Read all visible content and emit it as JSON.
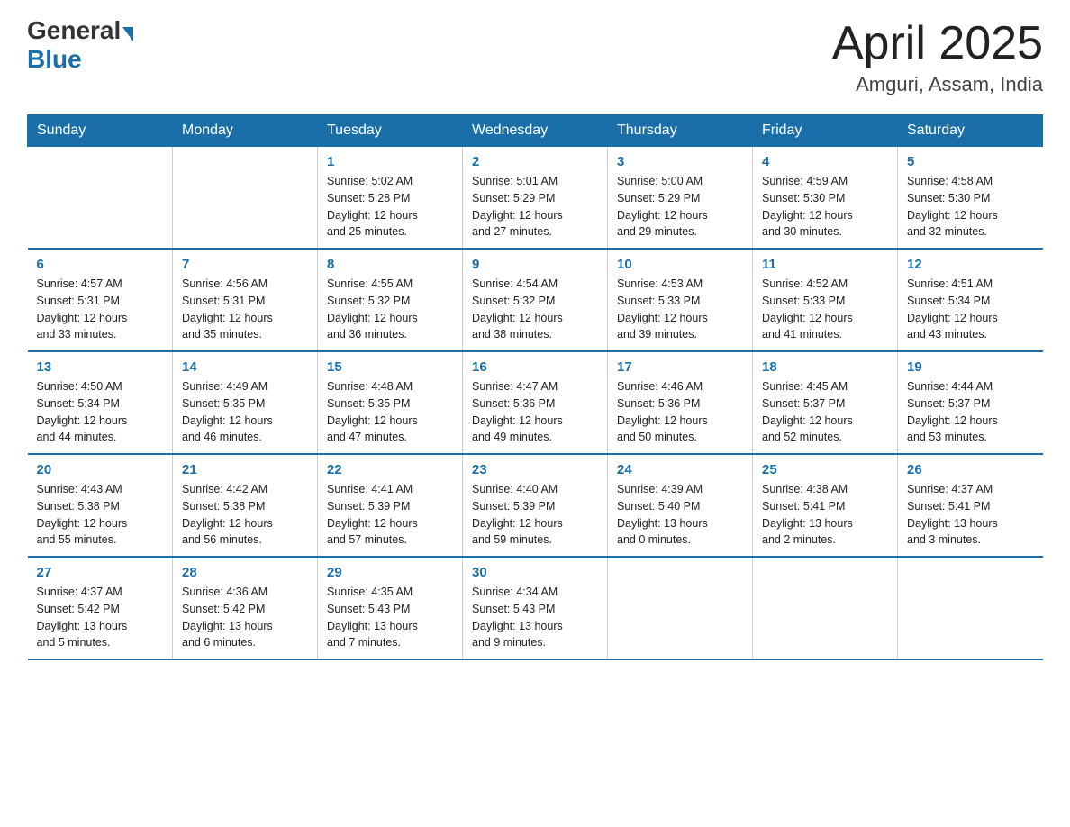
{
  "header": {
    "logo_general": "General",
    "logo_blue": "Blue",
    "month_title": "April 2025",
    "location": "Amguri, Assam, India"
  },
  "days_of_week": [
    "Sunday",
    "Monday",
    "Tuesday",
    "Wednesday",
    "Thursday",
    "Friday",
    "Saturday"
  ],
  "weeks": [
    [
      {
        "day": "",
        "info": ""
      },
      {
        "day": "",
        "info": ""
      },
      {
        "day": "1",
        "info": "Sunrise: 5:02 AM\nSunset: 5:28 PM\nDaylight: 12 hours\nand 25 minutes."
      },
      {
        "day": "2",
        "info": "Sunrise: 5:01 AM\nSunset: 5:29 PM\nDaylight: 12 hours\nand 27 minutes."
      },
      {
        "day": "3",
        "info": "Sunrise: 5:00 AM\nSunset: 5:29 PM\nDaylight: 12 hours\nand 29 minutes."
      },
      {
        "day": "4",
        "info": "Sunrise: 4:59 AM\nSunset: 5:30 PM\nDaylight: 12 hours\nand 30 minutes."
      },
      {
        "day": "5",
        "info": "Sunrise: 4:58 AM\nSunset: 5:30 PM\nDaylight: 12 hours\nand 32 minutes."
      }
    ],
    [
      {
        "day": "6",
        "info": "Sunrise: 4:57 AM\nSunset: 5:31 PM\nDaylight: 12 hours\nand 33 minutes."
      },
      {
        "day": "7",
        "info": "Sunrise: 4:56 AM\nSunset: 5:31 PM\nDaylight: 12 hours\nand 35 minutes."
      },
      {
        "day": "8",
        "info": "Sunrise: 4:55 AM\nSunset: 5:32 PM\nDaylight: 12 hours\nand 36 minutes."
      },
      {
        "day": "9",
        "info": "Sunrise: 4:54 AM\nSunset: 5:32 PM\nDaylight: 12 hours\nand 38 minutes."
      },
      {
        "day": "10",
        "info": "Sunrise: 4:53 AM\nSunset: 5:33 PM\nDaylight: 12 hours\nand 39 minutes."
      },
      {
        "day": "11",
        "info": "Sunrise: 4:52 AM\nSunset: 5:33 PM\nDaylight: 12 hours\nand 41 minutes."
      },
      {
        "day": "12",
        "info": "Sunrise: 4:51 AM\nSunset: 5:34 PM\nDaylight: 12 hours\nand 43 minutes."
      }
    ],
    [
      {
        "day": "13",
        "info": "Sunrise: 4:50 AM\nSunset: 5:34 PM\nDaylight: 12 hours\nand 44 minutes."
      },
      {
        "day": "14",
        "info": "Sunrise: 4:49 AM\nSunset: 5:35 PM\nDaylight: 12 hours\nand 46 minutes."
      },
      {
        "day": "15",
        "info": "Sunrise: 4:48 AM\nSunset: 5:35 PM\nDaylight: 12 hours\nand 47 minutes."
      },
      {
        "day": "16",
        "info": "Sunrise: 4:47 AM\nSunset: 5:36 PM\nDaylight: 12 hours\nand 49 minutes."
      },
      {
        "day": "17",
        "info": "Sunrise: 4:46 AM\nSunset: 5:36 PM\nDaylight: 12 hours\nand 50 minutes."
      },
      {
        "day": "18",
        "info": "Sunrise: 4:45 AM\nSunset: 5:37 PM\nDaylight: 12 hours\nand 52 minutes."
      },
      {
        "day": "19",
        "info": "Sunrise: 4:44 AM\nSunset: 5:37 PM\nDaylight: 12 hours\nand 53 minutes."
      }
    ],
    [
      {
        "day": "20",
        "info": "Sunrise: 4:43 AM\nSunset: 5:38 PM\nDaylight: 12 hours\nand 55 minutes."
      },
      {
        "day": "21",
        "info": "Sunrise: 4:42 AM\nSunset: 5:38 PM\nDaylight: 12 hours\nand 56 minutes."
      },
      {
        "day": "22",
        "info": "Sunrise: 4:41 AM\nSunset: 5:39 PM\nDaylight: 12 hours\nand 57 minutes."
      },
      {
        "day": "23",
        "info": "Sunrise: 4:40 AM\nSunset: 5:39 PM\nDaylight: 12 hours\nand 59 minutes."
      },
      {
        "day": "24",
        "info": "Sunrise: 4:39 AM\nSunset: 5:40 PM\nDaylight: 13 hours\nand 0 minutes."
      },
      {
        "day": "25",
        "info": "Sunrise: 4:38 AM\nSunset: 5:41 PM\nDaylight: 13 hours\nand 2 minutes."
      },
      {
        "day": "26",
        "info": "Sunrise: 4:37 AM\nSunset: 5:41 PM\nDaylight: 13 hours\nand 3 minutes."
      }
    ],
    [
      {
        "day": "27",
        "info": "Sunrise: 4:37 AM\nSunset: 5:42 PM\nDaylight: 13 hours\nand 5 minutes."
      },
      {
        "day": "28",
        "info": "Sunrise: 4:36 AM\nSunset: 5:42 PM\nDaylight: 13 hours\nand 6 minutes."
      },
      {
        "day": "29",
        "info": "Sunrise: 4:35 AM\nSunset: 5:43 PM\nDaylight: 13 hours\nand 7 minutes."
      },
      {
        "day": "30",
        "info": "Sunrise: 4:34 AM\nSunset: 5:43 PM\nDaylight: 13 hours\nand 9 minutes."
      },
      {
        "day": "",
        "info": ""
      },
      {
        "day": "",
        "info": ""
      },
      {
        "day": "",
        "info": ""
      }
    ]
  ]
}
